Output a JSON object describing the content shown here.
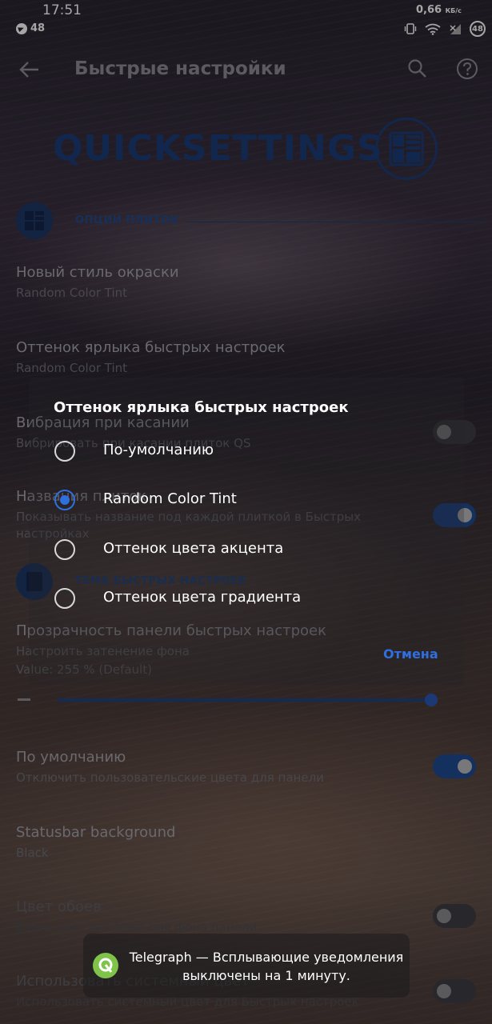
{
  "status_bar": {
    "time": "17:51",
    "notif_count": "48",
    "speed_value": "0,66",
    "speed_unit": "КБ/с",
    "battery": "48"
  },
  "toolbar": {
    "title": "Быстрые настройки"
  },
  "brand": {
    "title": "QUICKSETTINGS"
  },
  "sections": {
    "tiles": "ОПЦИИ ПЛИТОК",
    "theme": "ТЕМА БЫСТРЫХ НАСТРОЕК"
  },
  "prefs": {
    "color_style": {
      "title": "Новый стиль окраски",
      "summary": "Random Color Tint"
    },
    "label_tint": {
      "title": "Оттенок ярлыка быстрых настроек",
      "summary": "Random Color Tint"
    },
    "vibration": {
      "title": "Вибрация при касании",
      "summary": "Вибрировать при касании плиток QS",
      "enabled": false
    },
    "tile_names": {
      "title": "Названия плиток",
      "summary": "Показывать название под каждой плиткой в Быстрых настройках",
      "enabled": true
    },
    "panel_transparency": {
      "title": "Прозрачность панели быстрых настроек",
      "summary": "Настроить затенение фона",
      "value": "Value: 255 % (Default)",
      "level": 1.0
    },
    "default_colors": {
      "title": "По умолчанию",
      "summary": "Отключить пользовательские цвета для панели",
      "enabled": true
    },
    "statusbar_bg": {
      "title": "Statusbar background",
      "summary": "Black"
    },
    "wallpaper_color": {
      "title": "Цвет обоев",
      "summary": "Взять цвет из обоев для фона панели",
      "enabled": false
    },
    "system_color": {
      "title": "Использовать системный цвет",
      "summary": "Использовать системный цвет для Быстрых настроек",
      "enabled": false
    }
  },
  "dialog": {
    "title": "Оттенок ярлыка быстрых настроек",
    "options": [
      {
        "label": "По-умолчанию",
        "checked": false
      },
      {
        "label": "Random Color Tint",
        "checked": true
      },
      {
        "label": "Оттенок цвета акцента",
        "checked": false
      },
      {
        "label": "Оттенок цвета градиента",
        "checked": false
      }
    ],
    "cancel": "Отмена"
  },
  "toast": {
    "text": "Telegraph — Всплывающие уведомления выключены на 1 минуту."
  },
  "colors": {
    "accent": "#2f6fe0",
    "brand_blue": "#1c3c78",
    "toast_icon": "#7fc34a"
  }
}
